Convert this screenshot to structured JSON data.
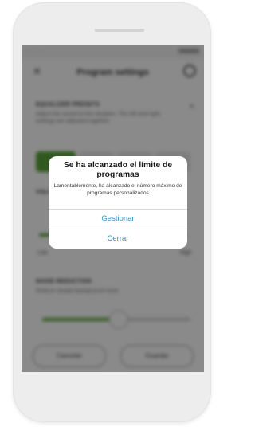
{
  "background_screen": {
    "nav_title": "Program settings",
    "equalizer_title": "EQUALIZER PRESETS",
    "equalizer_text": "Adjust the sound to the situation. The left and right settings are adjusted together.",
    "noise_title": "NOISE REDUCTION",
    "noise_text": "Reduce steady background noise",
    "low_label": "Low",
    "high_label": "High",
    "cancel_label": "Cancelar",
    "save_label": "Guardar"
  },
  "dialog": {
    "title": "Se ha alcanzado el límite de programas",
    "message": "Lamentablemente, ha alcanzado el número máximo de programas personalizados",
    "manage_label": "Gestionar",
    "close_label": "Cerrar"
  },
  "colors": {
    "accent_green": "#5aa33a",
    "link_blue": "#3f8cbf",
    "overlay": "rgba(0,0,0,0.46)"
  }
}
